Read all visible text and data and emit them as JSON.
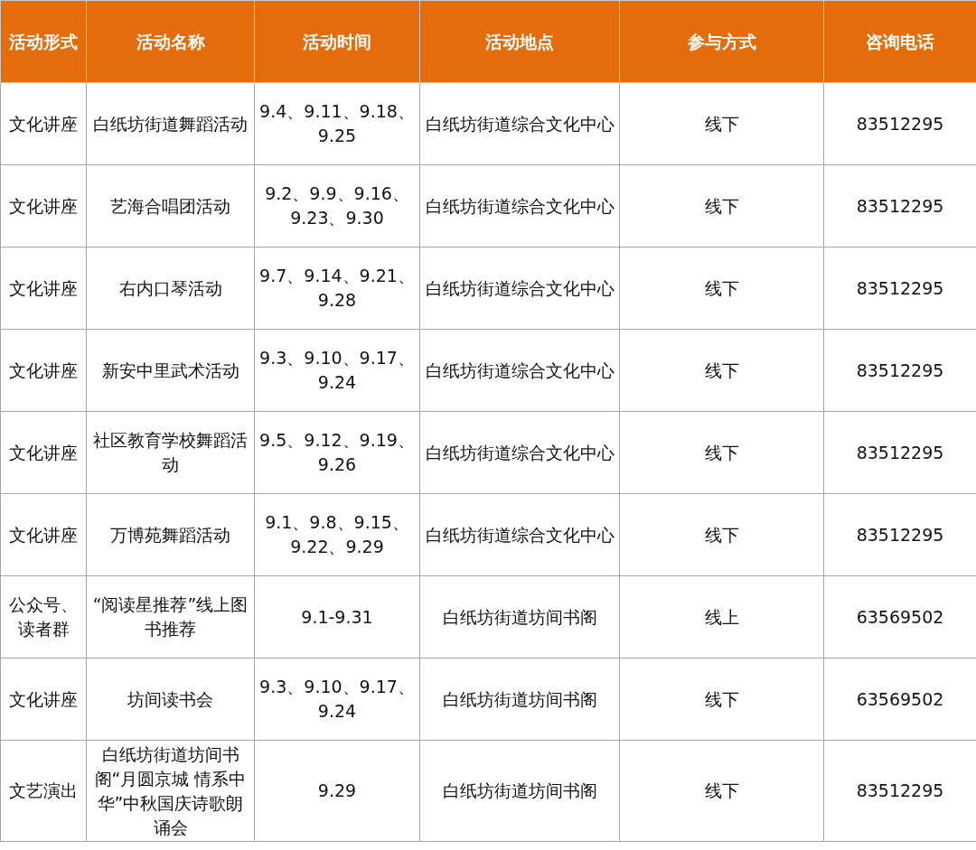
{
  "table": {
    "columns": [
      "活动形式",
      "活动名称",
      "活动时间",
      "活动地点",
      "参与方式",
      "咨询电话"
    ],
    "rows": [
      [
        "文化讲座",
        "白纸坊街道舞蹈活动",
        "9.4、9.11、9.18、9.25",
        "白纸坊街道综合文化中心",
        "线下",
        "83512295"
      ],
      [
        "文化讲座",
        "艺海合唱团活动",
        "9.2、9.9、9.16、9.23、9.30",
        "白纸坊街道综合文化中心",
        "线下",
        "83512295"
      ],
      [
        "文化讲座",
        "右内口琴活动",
        "9.7、9.14、9.21、9.28",
        "白纸坊街道综合文化中心",
        "线下",
        "83512295"
      ],
      [
        "文化讲座",
        "新安中里武术活动",
        "9.3、9.10、9.17、9.24",
        "白纸坊街道综合文化中心",
        "线下",
        "83512295"
      ],
      [
        "文化讲座",
        "社区教育学校舞蹈活动",
        "9.5、9.12、9.19、9.26",
        "白纸坊街道综合文化中心",
        "线下",
        "83512295"
      ],
      [
        "文化讲座",
        "万博苑舞蹈活动",
        "9.1、9.8、9.15、9.22、9.29",
        "白纸坊街道综合文化中心",
        "线下",
        "83512295"
      ],
      [
        "公众号、读者群",
        "“阅读星推荐”线上图书推荐",
        "9.1-9.31",
        "白纸坊街道坊间书阁",
        "线上",
        "63569502"
      ],
      [
        "文化讲座",
        "坊间读书会",
        "9.3、9.10、9.17、9.24",
        "白纸坊街道坊间书阁",
        "线下",
        "63569502"
      ],
      [
        "文艺演出",
        "白纸坊街道坊间书阁“月圆京城 情系中华”中秋国庆诗歌朗诵会",
        "9.29",
        "白纸坊街道坊间书阁",
        "线下",
        "83512295"
      ]
    ]
  }
}
